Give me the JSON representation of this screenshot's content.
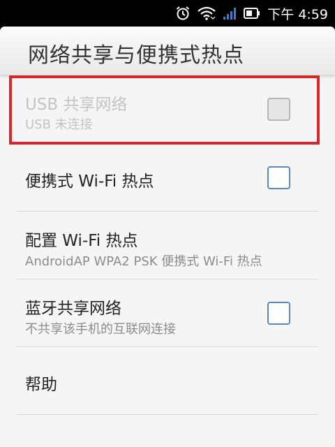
{
  "status_bar": {
    "icons": [
      "alarm-icon",
      "wifi-icon",
      "signal-icon",
      "battery-icon"
    ],
    "time": "下午 4:59"
  },
  "header": {
    "title": "网络共享与便携式热点"
  },
  "list": {
    "items": [
      {
        "title": "USB 共享网络",
        "subtitle": "USB 未连接",
        "has_checkbox": true,
        "checked": false,
        "enabled": false,
        "highlighted": true
      },
      {
        "title": "便携式 Wi-Fi 热点",
        "has_checkbox": true,
        "checked": false,
        "enabled": true
      },
      {
        "title": "配置 Wi-Fi 热点",
        "subtitle": "AndroidAP WPA2 PSK 便携式 Wi-Fi 热点",
        "has_checkbox": false,
        "enabled": true
      },
      {
        "title": "蓝牙共享网络",
        "subtitle": "不共享该手机的互联网连接",
        "has_checkbox": true,
        "checked": false,
        "enabled": true
      },
      {
        "title": "帮助",
        "has_checkbox": false,
        "enabled": true
      }
    ]
  },
  "colors": {
    "highlight_border": "#d9262b",
    "checkbox_border": "#5b88b6",
    "panel_background": "#f5f5f5",
    "status_bar_background": "#000000"
  }
}
